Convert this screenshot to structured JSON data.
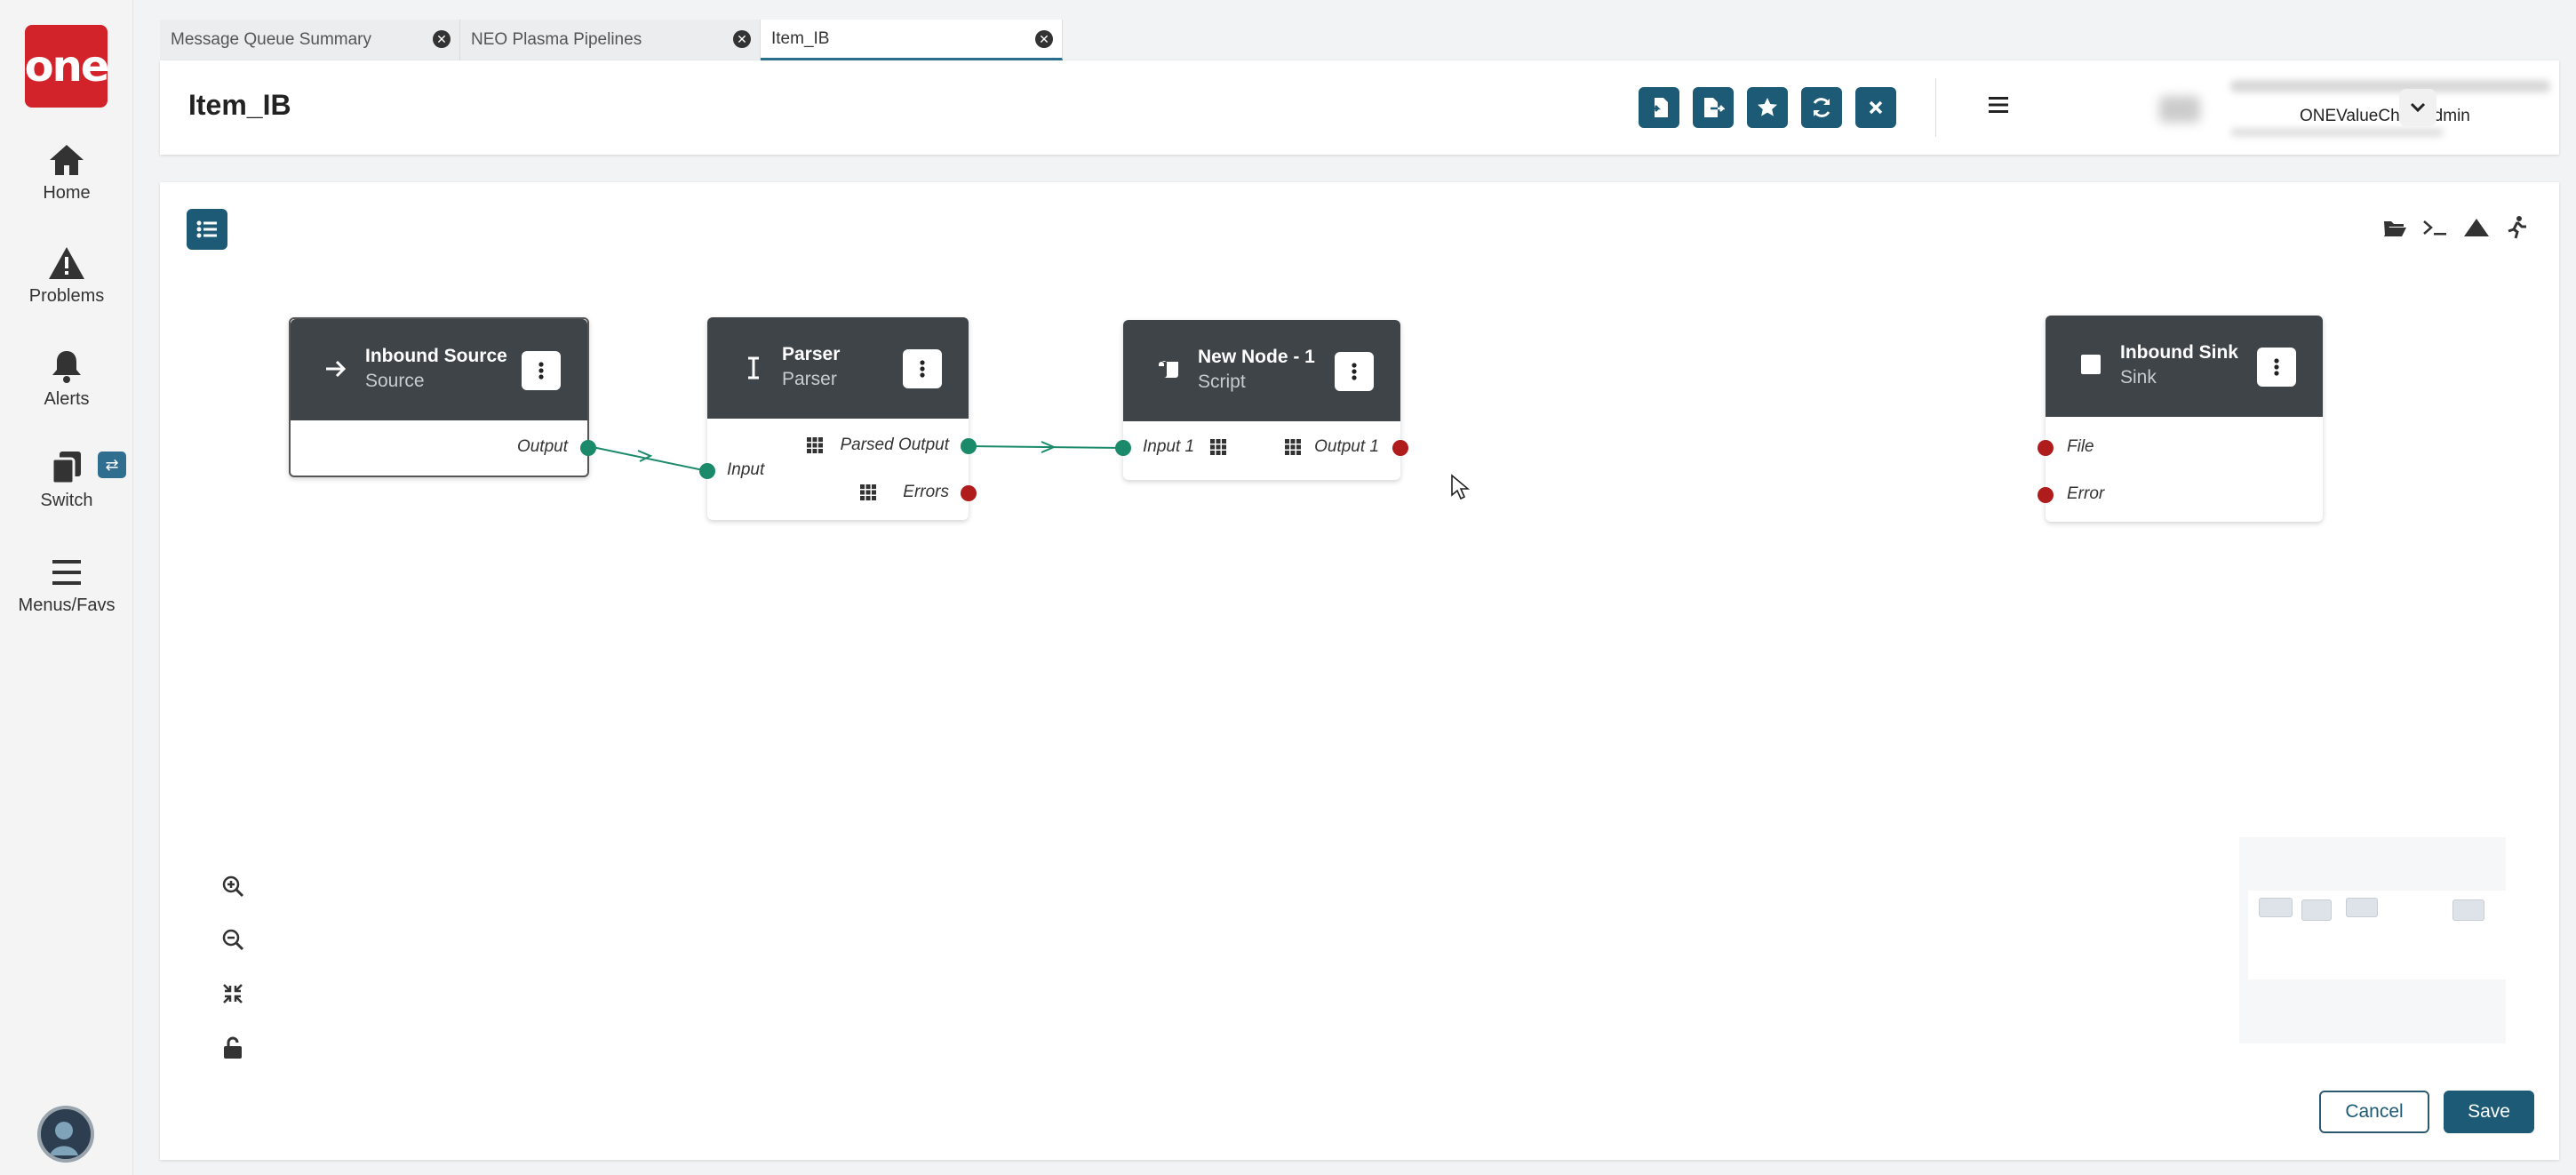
{
  "app": {
    "logo_text": "one",
    "brand_color": "#d3232a",
    "accent_color": "#1c5a75"
  },
  "sidebar": {
    "items": [
      {
        "label": "Home",
        "icon": "home-icon"
      },
      {
        "label": "Problems",
        "icon": "warning-icon"
      },
      {
        "label": "Alerts",
        "icon": "bell-icon"
      },
      {
        "label": "Switch",
        "icon": "switch-icon"
      },
      {
        "label": "Menus/Favs",
        "icon": "menu-icon"
      }
    ]
  },
  "tabs": [
    {
      "label": "Message Queue Summary",
      "active": false
    },
    {
      "label": "NEO Plasma Pipelines",
      "active": false
    },
    {
      "label": "Item_IB",
      "active": true
    }
  ],
  "header": {
    "title": "Item_IB",
    "toolbar_icons": [
      "import-icon",
      "export-icon",
      "star-icon",
      "refresh-icon",
      "close-icon"
    ],
    "user_name": "ONEValueChainAdmin"
  },
  "pipeline": {
    "nodes": [
      {
        "title": "Inbound Source",
        "subtitle": "Source",
        "icon": "arrow-right-icon",
        "ports": {
          "outputs": [
            "Output"
          ]
        }
      },
      {
        "title": "Parser",
        "subtitle": "Parser",
        "icon": "text-cursor-icon",
        "ports": {
          "inputs": [
            "Input"
          ],
          "outputs": [
            "Parsed Output",
            "Errors"
          ]
        }
      },
      {
        "title": "New Node - 1",
        "subtitle": "Script",
        "icon": "scroll-icon",
        "ports": {
          "inputs": [
            "Input 1"
          ],
          "outputs": [
            "Output 1"
          ]
        }
      },
      {
        "title": "Inbound Sink",
        "subtitle": "Sink",
        "icon": "square-icon",
        "ports": {
          "inputs": [
            "File",
            "Error"
          ]
        }
      }
    ],
    "tool_icons": [
      "folder-open-icon",
      "terminal-icon",
      "mountain-icon",
      "run-icon"
    ],
    "zoom_icons": [
      "zoom-in-icon",
      "zoom-out-icon",
      "fit-icon",
      "unlock-icon"
    ]
  },
  "footer": {
    "cancel_label": "Cancel",
    "save_label": "Save"
  }
}
